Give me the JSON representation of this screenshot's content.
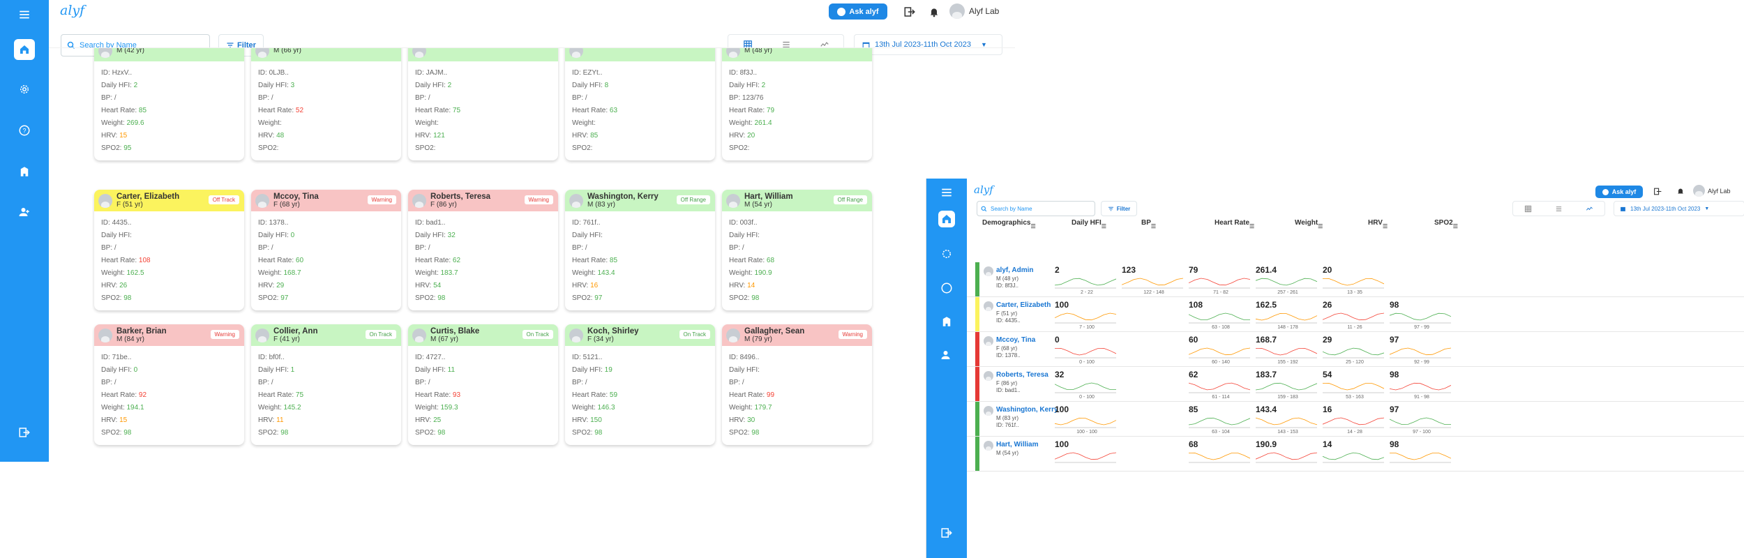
{
  "app": {
    "logo": "alyf",
    "ask_label": "Ask alyf",
    "user_name": "Alyf Lab",
    "search_placeholder": "Search by Name",
    "filter_label": "Filter",
    "date_range": "13th Jul 2023-11th Oct 2023",
    "date_range_small": "13th Jul 2023-11th Oct 2023"
  },
  "labels": {
    "id": "ID:",
    "hfi": "Daily HFI:",
    "bp": "BP:",
    "hr": "Heart Rate:",
    "weight": "Weight:",
    "hrv": "HRV:",
    "spo2": "SPO2:"
  },
  "colors": {
    "accent": "#2196f3",
    "green_head": "#c8f5c2",
    "yellow_head": "#fbf35e",
    "red_head": "#f8c4c4",
    "green_strip": "#4caf50",
    "yellow_strip": "#fbf35e",
    "red_strip": "#e53935"
  },
  "cards_top": [
    {
      "age": "M (42 yr)",
      "id": "HzxV..",
      "hfi": "2",
      "bp": "/",
      "hr": "85",
      "weight": "269.6",
      "hrv": "15",
      "spo2": "95"
    },
    {
      "age": "M (66 yr)",
      "id": "0LJB..",
      "hfi": "3",
      "bp": "/",
      "hr": "52",
      "weight": "",
      "hrv": "48",
      "spo2": ""
    },
    {
      "age": "",
      "id": "JAJM..",
      "hfi": "2",
      "bp": "/",
      "hr": "75",
      "weight": "",
      "hrv": "121",
      "spo2": ""
    },
    {
      "age": "",
      "id": "EZYt..",
      "hfi": "8",
      "bp": "/",
      "hr": "63",
      "weight": "",
      "hrv": "85",
      "spo2": ""
    },
    {
      "age": "M (48 yr)",
      "id": "8f3J..",
      "hfi": "2",
      "bp": "123/76",
      "hr": "79",
      "weight": "261.4",
      "hrv": "20",
      "spo2": ""
    }
  ],
  "cards_mid": [
    {
      "name": "Carter, Elizabeth",
      "age": "F (51 yr)",
      "badge": "Off Track",
      "id": "4435..",
      "hfi": "",
      "bp": "/",
      "hr": "108",
      "weight": "162.5",
      "hrv": "26",
      "spo2": "98"
    },
    {
      "name": "Mccoy, Tina",
      "age": "F (68 yr)",
      "badge": "Warning",
      "id": "1378..",
      "hfi": "0",
      "bp": "/",
      "hr": "60",
      "weight": "168.7",
      "hrv": "29",
      "spo2": "97"
    },
    {
      "name": "Roberts, Teresa",
      "age": "F (86 yr)",
      "badge": "Warning",
      "id": "bad1..",
      "hfi": "32",
      "bp": "/",
      "hr": "62",
      "weight": "183.7",
      "hrv": "54",
      "spo2": "98"
    },
    {
      "name": "Washington, Kerry",
      "age": "M (83 yr)",
      "badge": "Off Range",
      "id": "761f..",
      "hfi": "",
      "bp": "/",
      "hr": "85",
      "weight": "143.4",
      "hrv": "16",
      "spo2": "97"
    },
    {
      "name": "Hart, William",
      "age": "M (54 yr)",
      "badge": "Off Range",
      "id": "003f..",
      "hfi": "",
      "bp": "/",
      "hr": "68",
      "weight": "190.9",
      "hrv": "14",
      "spo2": "98"
    }
  ],
  "cards_bot": [
    {
      "name": "Barker, Brian",
      "age": "M (84 yr)",
      "badge": "Warning",
      "id": "71be..",
      "hfi": "0",
      "bp": "/",
      "hr": "92",
      "weight": "194.1",
      "hrv": "15",
      "spo2": "98"
    },
    {
      "name": "Collier, Ann",
      "age": "F (41 yr)",
      "badge": "On Track",
      "id": "bf0f..",
      "hfi": "1",
      "bp": "/",
      "hr": "75",
      "weight": "145.2",
      "hrv": "11",
      "spo2": "98"
    },
    {
      "name": "Curtis, Blake",
      "age": "M (67 yr)",
      "badge": "On Track",
      "id": "4727..",
      "hfi": "11",
      "bp": "/",
      "hr": "93",
      "weight": "159.3",
      "hrv": "25",
      "spo2": "98"
    },
    {
      "name": "Koch, Shirley",
      "age": "F (34 yr)",
      "badge": "On Track",
      "id": "5121..",
      "hfi": "19",
      "bp": "/",
      "hr": "59",
      "weight": "146.3",
      "hrv": "150",
      "spo2": "98"
    },
    {
      "name": "Gallagher, Sean",
      "age": "M (79 yr)",
      "badge": "Warning",
      "id": "8496..",
      "hfi": "",
      "bp": "/",
      "hr": "99",
      "weight": "179.7",
      "hrv": "30",
      "spo2": "98"
    }
  ],
  "table": {
    "headers": [
      "Demographics",
      "Daily HFI",
      "BP",
      "Heart Rate",
      "Weight",
      "HRV",
      "SPO2"
    ],
    "rows": [
      {
        "name": "alyf, Admin",
        "age": "M (48 yr)",
        "id": "ID: 8f3J..",
        "status": "green",
        "vals": [
          "2",
          "123",
          "79",
          "261.4",
          "20",
          ""
        ],
        "ranges": [
          "2 - 22",
          "122 - 148",
          "71 - 82",
          "257 - 261",
          "13 - 35",
          ""
        ]
      },
      {
        "name": "Carter, Elizabeth",
        "age": "F (51 yr)",
        "id": "ID: 4435..",
        "status": "yellow",
        "vals": [
          "100",
          "",
          "108",
          "162.5",
          "26",
          "98"
        ],
        "ranges": [
          "7 - 100",
          "",
          "63 - 108",
          "148 - 178",
          "11 - 26",
          "97 - 99"
        ]
      },
      {
        "name": "Mccoy, Tina",
        "age": "F (68 yr)",
        "id": "ID: 1378..",
        "status": "red",
        "vals": [
          "0",
          "",
          "60",
          "168.7",
          "29",
          "97"
        ],
        "ranges": [
          "0 - 100",
          "",
          "60 - 140",
          "155 - 192",
          "25 - 120",
          "92 - 99"
        ]
      },
      {
        "name": "Roberts, Teresa",
        "age": "F (86 yr)",
        "id": "ID: bad1..",
        "status": "red",
        "vals": [
          "32",
          "",
          "62",
          "183.7",
          "54",
          "98"
        ],
        "ranges": [
          "0 - 100",
          "",
          "61 - 114",
          "159 - 183",
          "53 - 163",
          "91 - 98"
        ]
      },
      {
        "name": "Washington, Kerry",
        "age": "M (83 yr)",
        "id": "ID: 761f..",
        "status": "green",
        "vals": [
          "100",
          "",
          "85",
          "143.4",
          "16",
          "97"
        ],
        "ranges": [
          "100 - 100",
          "",
          "63 - 104",
          "143 - 153",
          "14 - 28",
          "97 - 100"
        ]
      },
      {
        "name": "Hart, William",
        "age": "M (54 yr)",
        "id": "",
        "status": "green",
        "vals": [
          "100",
          "",
          "68",
          "190.9",
          "14",
          "98"
        ],
        "ranges": [
          "",
          "",
          "",
          "",
          "",
          ""
        ]
      }
    ]
  }
}
